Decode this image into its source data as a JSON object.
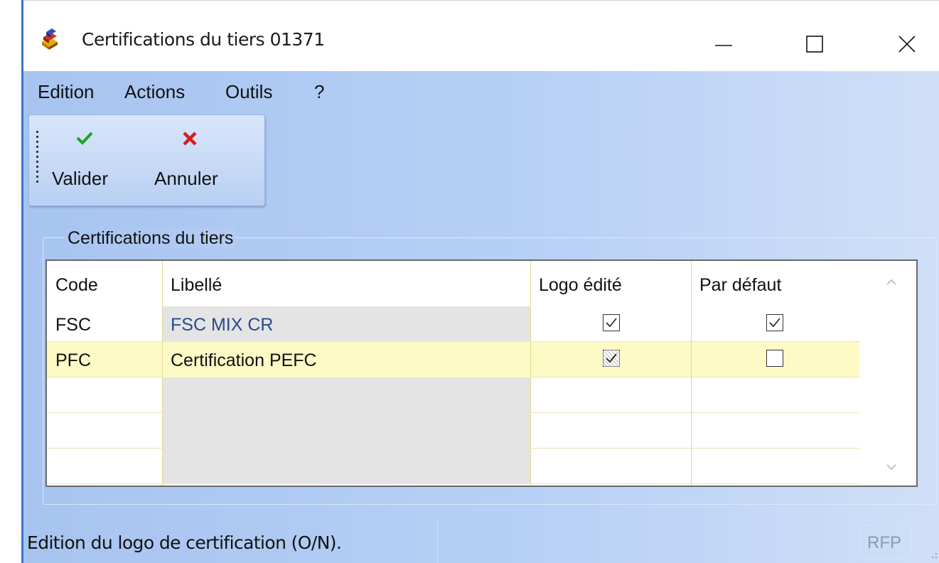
{
  "window": {
    "title": "Certifications du tiers 01371",
    "controls": {
      "minimize": "—",
      "maximize": "☐",
      "close": "✕"
    }
  },
  "menu": {
    "items": [
      "Edition",
      "Actions",
      "Outils",
      "?"
    ]
  },
  "toolbar": {
    "validate_label": "Valider",
    "cancel_label": "Annuler",
    "validate_color": "#1fa31f",
    "cancel_color": "#d81e1e"
  },
  "group": {
    "title": "Certifications du tiers"
  },
  "grid": {
    "columns": [
      "Code",
      "Libellé",
      "Logo édité",
      "Par défaut"
    ],
    "rows": [
      {
        "code": "FSC",
        "libelle": "FSC MIX CR",
        "logo_edite": true,
        "par_defaut": true,
        "selected": false
      },
      {
        "code": "PFC",
        "libelle": "Certification PEFC",
        "logo_edite": true,
        "par_defaut": false,
        "selected": true
      },
      {
        "code": "",
        "libelle": "",
        "logo_edite": null,
        "par_defaut": null,
        "selected": false
      },
      {
        "code": "",
        "libelle": "",
        "logo_edite": null,
        "par_defaut": null,
        "selected": false
      },
      {
        "code": "",
        "libelle": "",
        "logo_edite": null,
        "par_defaut": null,
        "selected": false
      }
    ],
    "selected_row_color": "#fdfac6"
  },
  "status": {
    "message": "Edition du logo de certification (O/N).",
    "indicator": "RFP"
  }
}
